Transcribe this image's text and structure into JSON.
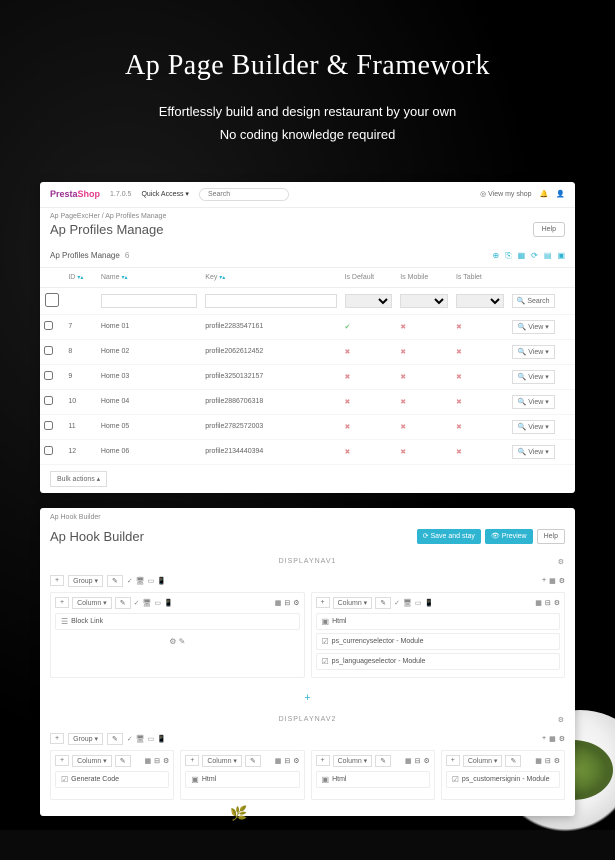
{
  "hero": {
    "title": "Ap Page Builder & Framework",
    "line1": "Effortlessly build and design restaurant by your own",
    "line2": "No coding knowledge required"
  },
  "panel1": {
    "logo1": "Presta",
    "logo2": "Shop",
    "version": "1.7.0.5",
    "quick_access": "Quick Access ▾",
    "search_placeholder": "Search",
    "view_shop": "◎ View my shop",
    "breadcrumb": "Ap PageExcHer  /  Ap Profiles Manage",
    "title": "Ap Profiles Manage",
    "help": "Help",
    "table_name": "Ap Profiles Manage",
    "count": "6",
    "cols": {
      "id": "ID",
      "name": "Name",
      "key": "Key",
      "default": "Is Default",
      "mobile": "Is Mobile",
      "tablet": "Is Tablet"
    },
    "search_label": "Search",
    "view_label": "View",
    "bulk": "Bulk actions ▴",
    "rows": [
      {
        "id": "7",
        "name": "Home 01",
        "key": "profile2283547161",
        "d": "✔",
        "m": "✖",
        "t": "✖"
      },
      {
        "id": "8",
        "name": "Home 02",
        "key": "profile2062612452",
        "d": "✖",
        "m": "✖",
        "t": "✖"
      },
      {
        "id": "9",
        "name": "Home 03",
        "key": "profile3250132157",
        "d": "✖",
        "m": "✖",
        "t": "✖"
      },
      {
        "id": "10",
        "name": "Home 04",
        "key": "profile2886706318",
        "d": "✖",
        "m": "✖",
        "t": "✖"
      },
      {
        "id": "11",
        "name": "Home 05",
        "key": "profile2782572003",
        "d": "✖",
        "m": "✖",
        "t": "✖"
      },
      {
        "id": "12",
        "name": "Home 06",
        "key": "profile2134440394",
        "d": "✖",
        "m": "✖",
        "t": "✖"
      }
    ]
  },
  "panel2": {
    "breadcrumb": "Ap Hook Builder",
    "title": "Ap Hook Builder",
    "save_stay": "⟳ Save and stay",
    "preview": "👁 Preview",
    "help": "Help",
    "section1": "DISPLAYNAV1",
    "section2": "DISPLAYNAV2",
    "group": "Group ▾",
    "column": "Column ▾",
    "block_link": "Block Link",
    "html": "Html",
    "currency": "ps_currencyselector - Module",
    "language": "ps_languageselector - Module",
    "gencode": "Generate Code",
    "customer": "ps_customersignin - Module",
    "plus": "+"
  }
}
